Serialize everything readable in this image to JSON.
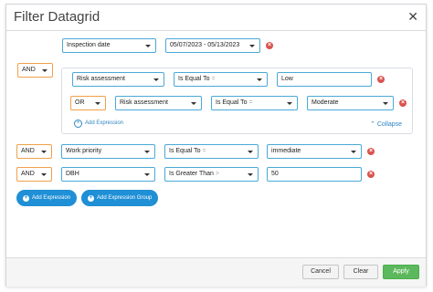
{
  "dialog": {
    "title": "Filter Datagrid",
    "close_glyph": "✕"
  },
  "rows": [
    {
      "field": "Inspection date",
      "value": "05/07/2023 - 05/13/2023"
    }
  ],
  "group": {
    "logic": "AND",
    "rows": [
      {
        "field": "Risk assessment",
        "operator": "Is Equal To",
        "op_symbol": "=",
        "value": "Low"
      },
      {
        "logic": "OR",
        "field": "Risk assessment",
        "operator": "Is Equal To",
        "op_symbol": "=",
        "value": "Moderate"
      }
    ],
    "add_expression": "Add Expression",
    "collapse": "Collapse"
  },
  "row_work": {
    "logic": "AND",
    "field": "Work priority",
    "operator": "Is Equal To",
    "op_symbol": "=",
    "value": "immediate"
  },
  "row_dbh": {
    "logic": "AND",
    "field": "DBH",
    "operator": "Is Greater Than",
    "op_symbol": ">",
    "value": "50"
  },
  "buttons": {
    "add_expression": "Add Expression",
    "add_expression_group": "Add Expression Group",
    "cancel": "Cancel",
    "clear": "Clear",
    "apply": "Apply"
  },
  "colors": {
    "accent": "#1f8fd6",
    "remove": "#d9534f",
    "apply": "#5cb85c"
  },
  "icons": {
    "remove": "remove-icon",
    "dropdown": "chevron-down-icon",
    "add": "plus-circle-icon",
    "collapse": "chevron-up-icon"
  }
}
